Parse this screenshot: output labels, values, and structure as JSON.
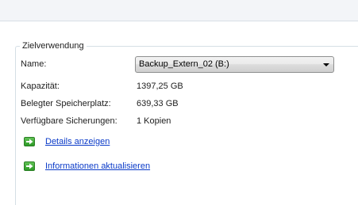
{
  "group": {
    "title": "Zielverwendung"
  },
  "fields": {
    "name_label": "Name:",
    "drive_selected": "Backup_Extern_02 (B:)",
    "capacity_label": "Kapazität:",
    "capacity_value": "1397,25 GB",
    "used_label": "Belegter Speicherplatz:",
    "used_value": "639,33 GB",
    "backups_label": "Verfügbare Sicherungen:",
    "backups_value": "1 Kopien"
  },
  "links": {
    "details": "Details anzeigen",
    "refresh": "Informationen aktualisieren"
  },
  "icons": {
    "details": "green-arrow-icon",
    "refresh": "green-arrow-icon"
  },
  "colors": {
    "link": "#0a3ac8",
    "icon_green": "#2c9a25"
  }
}
